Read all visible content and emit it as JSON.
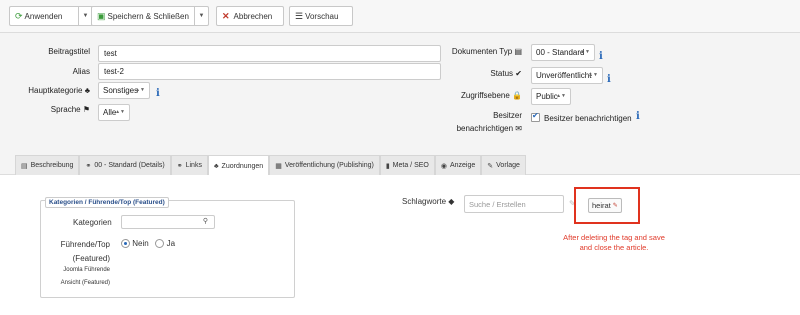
{
  "toolbar": {
    "apply": "Anwenden",
    "save_close": "Speichern & Schließen",
    "cancel": "Abbrechen",
    "preview": "Vorschau"
  },
  "form": {
    "title_label": "Beitragstitel",
    "title_value": "test",
    "alias_label": "Alias",
    "alias_value": "test-2",
    "category_label": "Hauptkategorie",
    "category_value": "Sonstiges",
    "language_label": "Sprache",
    "language_value": "Alle",
    "doctype_label": "Dokumenten Typ",
    "doctype_value": "00 - Standard",
    "status_label": "Status",
    "status_value": "Unveröffentlicht",
    "access_label": "Zugriffsebene",
    "access_value": "Public",
    "notify_label_1": "Besitzer",
    "notify_label_2": "benachrichtigen",
    "notify_checkbox_label": "Besitzer benachrichtigen",
    "notify_checked": true
  },
  "tabs": [
    {
      "label": "Beschreibung",
      "icon": "file-icon"
    },
    {
      "label": "00 - Standard (Details)",
      "icon": "link-icon"
    },
    {
      "label": "Links",
      "icon": "link-icon"
    },
    {
      "label": "Zuordnungen",
      "icon": "sitemap-icon",
      "active": true
    },
    {
      "label": "Veröffentlichung (Publishing)",
      "icon": "calendar-icon"
    },
    {
      "label": "Meta / SEO",
      "icon": "chart-icon"
    },
    {
      "label": "Anzeige",
      "icon": "eye-icon"
    },
    {
      "label": "Vorlage",
      "icon": "brush-icon"
    }
  ],
  "assignments": {
    "legend": "Kategorien / Führende/Top (Featured)",
    "categories_label": "Kategorien",
    "featured_label_1": "Führende/Top",
    "featured_label_2": "(Featured)",
    "featured_no": "Nein",
    "featured_yes": "Ja",
    "featured_selected": "no",
    "joomla_label_1": "Joomla Führende",
    "joomla_label_2": "Ansicht (Featured)"
  },
  "tags": {
    "label": "Schlagworte",
    "placeholder": "Suche / Erstellen",
    "tag_value": "heirat"
  },
  "annotation": {
    "note": "After deleting the tag and save and close the article.",
    "color": "#e0321e"
  }
}
